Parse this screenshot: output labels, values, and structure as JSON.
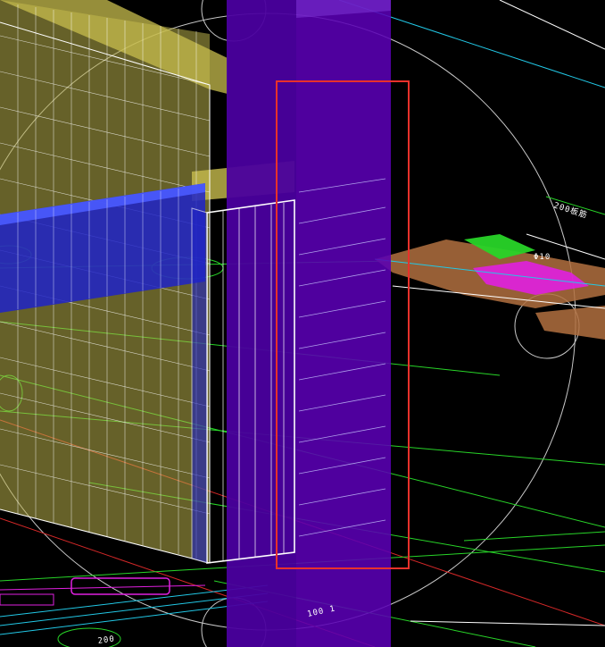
{
  "viewport": {
    "background": "#000000"
  },
  "colors": {
    "column_fill": "#5a00b4",
    "column_fill_dark": "#3f0090",
    "wall_fill": "#b9b04a",
    "wall_cap": "#c8bd4e",
    "beam_fill": "#1e23c8",
    "beam_edge": "#4a5bff",
    "selection": "#e8312b",
    "wire": "#ffffff",
    "axis_green": "#28d428",
    "axis_red": "#d42828",
    "axis_cyan": "#22c8e6",
    "hatch_orange": "#b27040",
    "hatch_magenta": "#e020e0",
    "circle_grey": "#c8c8c8"
  },
  "labels": {
    "label_top_right": "200板筋",
    "label_dim": "Φ10",
    "label_bottom_left": "100 1",
    "label_bottom": "200"
  },
  "selection": {
    "state": "selected"
  }
}
